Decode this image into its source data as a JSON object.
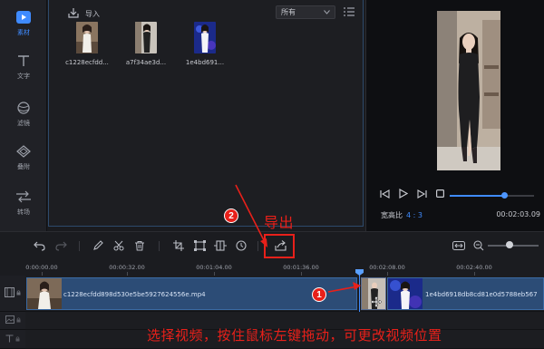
{
  "nav": {
    "items": [
      {
        "label": "素材",
        "icon": "media-icon",
        "active": true
      },
      {
        "label": "文字",
        "icon": "text-icon",
        "active": false
      },
      {
        "label": "滤镜",
        "icon": "filter-icon",
        "active": false
      },
      {
        "label": "叠附",
        "icon": "overlay-icon",
        "active": false
      },
      {
        "label": "转场",
        "icon": "transition-icon",
        "active": false
      }
    ]
  },
  "media": {
    "import_label": "导入",
    "filter_value": "所有",
    "files": [
      {
        "name": "c1228ecfdd..."
      },
      {
        "name": "a7f34ae3d..."
      },
      {
        "name": "1e4bd691..."
      }
    ]
  },
  "preview": {
    "aspect_label": "宽高比",
    "aspect_value": "4 : 3",
    "timecode": "00:02:03.09",
    "progress_fraction": 0.65
  },
  "ruler": {
    "labels": [
      "0:00:00.00",
      "00:00:32.00",
      "00:01:04.00",
      "00:01:36.00",
      "00:02:08.00",
      "00:02:40.00"
    ]
  },
  "timeline": {
    "clip1_label": "c1228ecfdd898d530e5be5927624556e.mp4",
    "clip2_label": "1e4bd6918db8cd81e0d5788eb567"
  },
  "annotations": {
    "badge1": "1",
    "badge2": "2",
    "export_label": "导出",
    "instruction": "选择视频，按住鼠标左键拖动，可更改视频位置"
  },
  "colors": {
    "accent": "#3f8bff",
    "annotation": "#e8201a",
    "clip": "#2c4c76"
  }
}
